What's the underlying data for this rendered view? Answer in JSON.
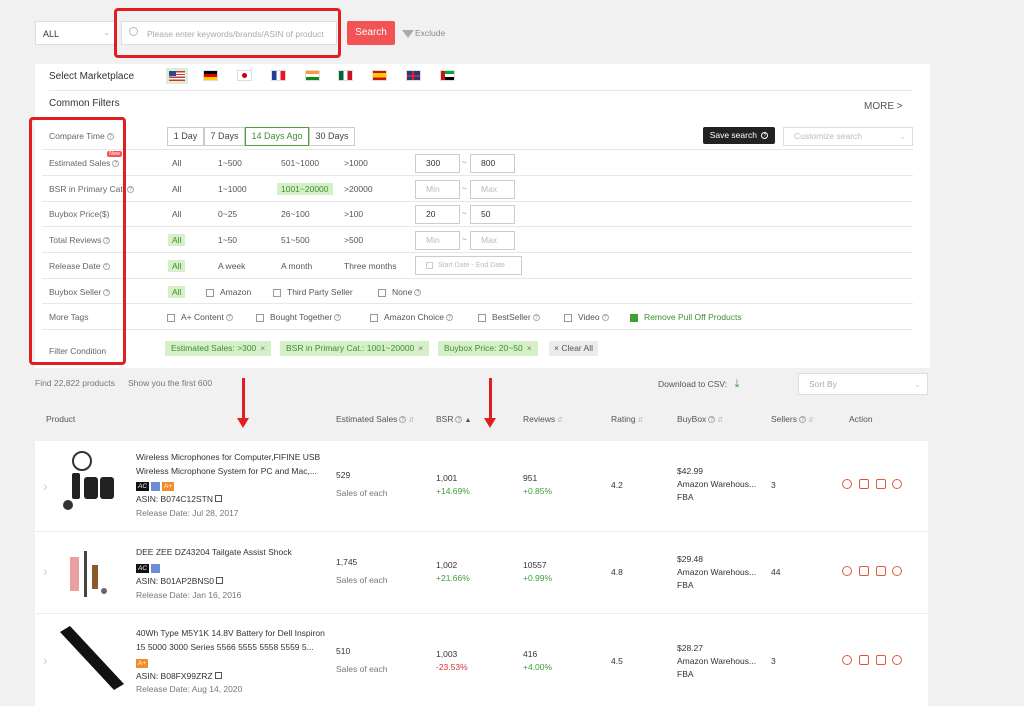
{
  "search": {
    "category": "ALL",
    "placeholder": "Please enter keywords/brands/ASIN of product",
    "button": "Search",
    "exclude": "Exclude"
  },
  "marketplace": {
    "label": "Select Marketplace",
    "flags": [
      "us-flag-icon",
      "de-flag-icon",
      "jp-flag-icon",
      "fr-flag-icon",
      "in-flag-icon",
      "mx-flag-icon",
      "es-flag-icon",
      "uk-flag-icon",
      "ae-flag-icon"
    ],
    "selected": "us-flag-icon"
  },
  "filters": {
    "title": "Common Filters",
    "more": "MORE >",
    "compare_time": {
      "label": "Compare Time",
      "options": [
        "1 Day",
        "7 Days",
        "14 Days Ago",
        "30 Days"
      ],
      "selected": "14 Days Ago"
    },
    "save_search": "Save search",
    "customize_search": "Customize search",
    "estimated_sales": {
      "label": "Estimated Sales",
      "new": "New",
      "options": [
        "All",
        "1~500",
        "501~1000",
        ">1000"
      ],
      "min": "300",
      "max": "800"
    },
    "bsr": {
      "label": "BSR in Primary Cat.",
      "options": [
        "All",
        "1~1000",
        "1001~20000",
        ">20000"
      ],
      "selected": "1001~20000",
      "min": "Min",
      "max": "Max"
    },
    "buybox_price": {
      "label": "Buybox Price($)",
      "options": [
        "All",
        "0~25",
        "26~100",
        ">100"
      ],
      "min": "20",
      "max": "50"
    },
    "total_reviews": {
      "label": "Total Reviews",
      "options": [
        "All",
        "1~50",
        "51~500",
        ">500"
      ],
      "selected": "All",
      "min": "Min",
      "max": "Max"
    },
    "release_date": {
      "label": "Release Date",
      "options": [
        "All",
        "A week",
        "A month",
        "Three months"
      ],
      "selected": "All",
      "start": "Start Date",
      "end": "End Date"
    },
    "buybox_seller": {
      "label": "Buybox Seller",
      "options": [
        "All",
        "Amazon",
        "Third Party Seller",
        "None"
      ],
      "selected": "All"
    },
    "more_tags": {
      "label": "More Tags",
      "options": [
        "A+ Content",
        "Bought Together",
        "Amazon Choice",
        "BestSeller",
        "Video",
        "Remove Pull Off Products"
      ],
      "checked": "Remove Pull Off Products"
    },
    "filter_condition": {
      "label": "Filter Condition",
      "chips": [
        "Estimated Sales: >300",
        "BSR in Primary Cat.: 1001~20000",
        "Buybox Price: 20~50"
      ],
      "clear": "Clear All"
    }
  },
  "results": {
    "found": "Find 22,822 products",
    "first": "Show you the first 600",
    "csv": "Download to CSV:",
    "sort": "Sort By"
  },
  "columns": [
    "Product",
    "Estimated Sales",
    "BSR",
    "Reviews",
    "Rating",
    "BuyBox",
    "Sellers",
    "Action"
  ],
  "products": [
    {
      "title": "Wireless Microphones for Computer,FIFINE USB Wireless Microphone System for PC and Mac,...",
      "asin": "ASIN: B074C12STN",
      "release": "Release Date: Jul 28, 2017",
      "sales": "529",
      "sales_sub": "Sales of each",
      "bsr": "1,001",
      "bsr_change": "+14.69%",
      "reviews": "951",
      "reviews_change": "+0.85%",
      "rating": "4.2",
      "price": "$42.99",
      "seller": "Amazon Warehous...",
      "fba": "FBA",
      "sellers": "3"
    },
    {
      "title": "DEE ZEE DZ43204 Tailgate Assist Shock",
      "asin": "ASIN: B01AP2BNS0",
      "release": "Release Date: Jan 16, 2016",
      "sales": "1,745",
      "sales_sub": "Sales of each",
      "bsr": "1,002",
      "bsr_change": "+21.66%",
      "reviews": "10557",
      "reviews_change": "+0.99%",
      "rating": "4.8",
      "price": "$29.48",
      "seller": "Amazon Warehous...",
      "fba": "FBA",
      "sellers": "44"
    },
    {
      "title": "40Wh Type M5Y1K 14.8V Battery for Dell Inspiron 15 5000 3000 Series 5566 5555 5558 5559 5...",
      "asin": "ASIN: B08FX99ZRZ",
      "release": "Release Date: Aug 14, 2020",
      "sales": "510",
      "sales_sub": "Sales of each",
      "bsr": "1,003",
      "bsr_change": "-23.53%",
      "reviews": "416",
      "reviews_change": "+4.00%",
      "rating": "4.5",
      "price": "$28.27",
      "seller": "Amazon Warehous...",
      "fba": "FBA",
      "sellers": "3"
    }
  ],
  "badges": {
    "ac": "AC",
    "aplus": "A+"
  },
  "colors": {
    "accent": "#f25455",
    "green": "#3f8f33",
    "highlight": "#e02020"
  }
}
